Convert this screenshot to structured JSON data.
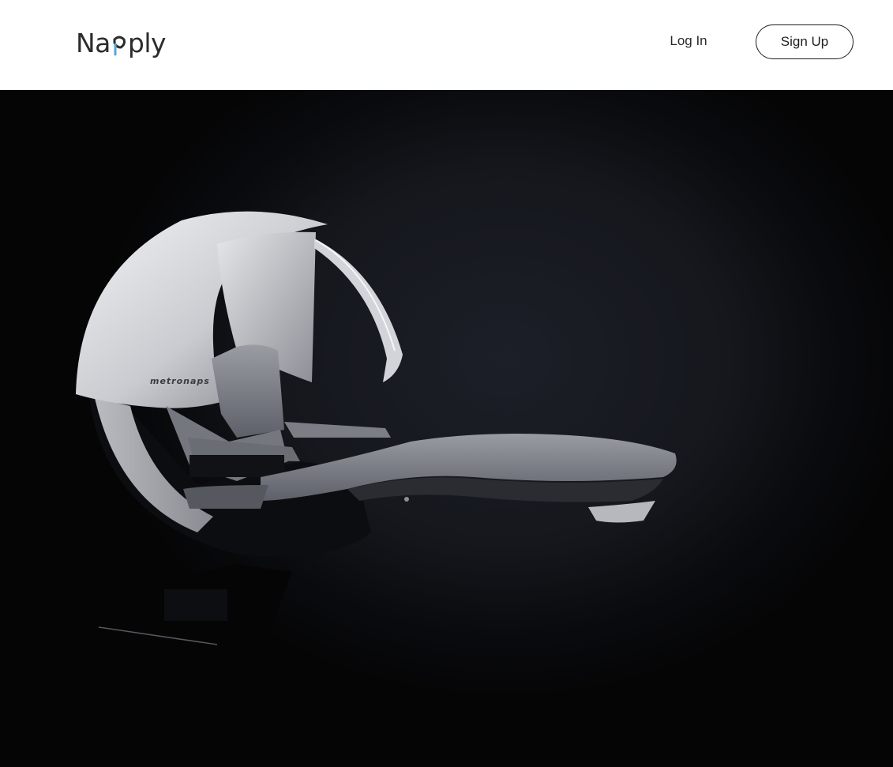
{
  "header": {
    "logo_text_start": "Na",
    "logo_text_end": "ply",
    "login_label": "Log In",
    "signup_label": "Sign Up"
  },
  "hero": {
    "pod_brand": "metronaps"
  },
  "colors": {
    "header_bg": "#ffffff",
    "hero_bg": "#14161c",
    "text": "#2a2a2a",
    "logo_accent": "#5aa7d8"
  }
}
